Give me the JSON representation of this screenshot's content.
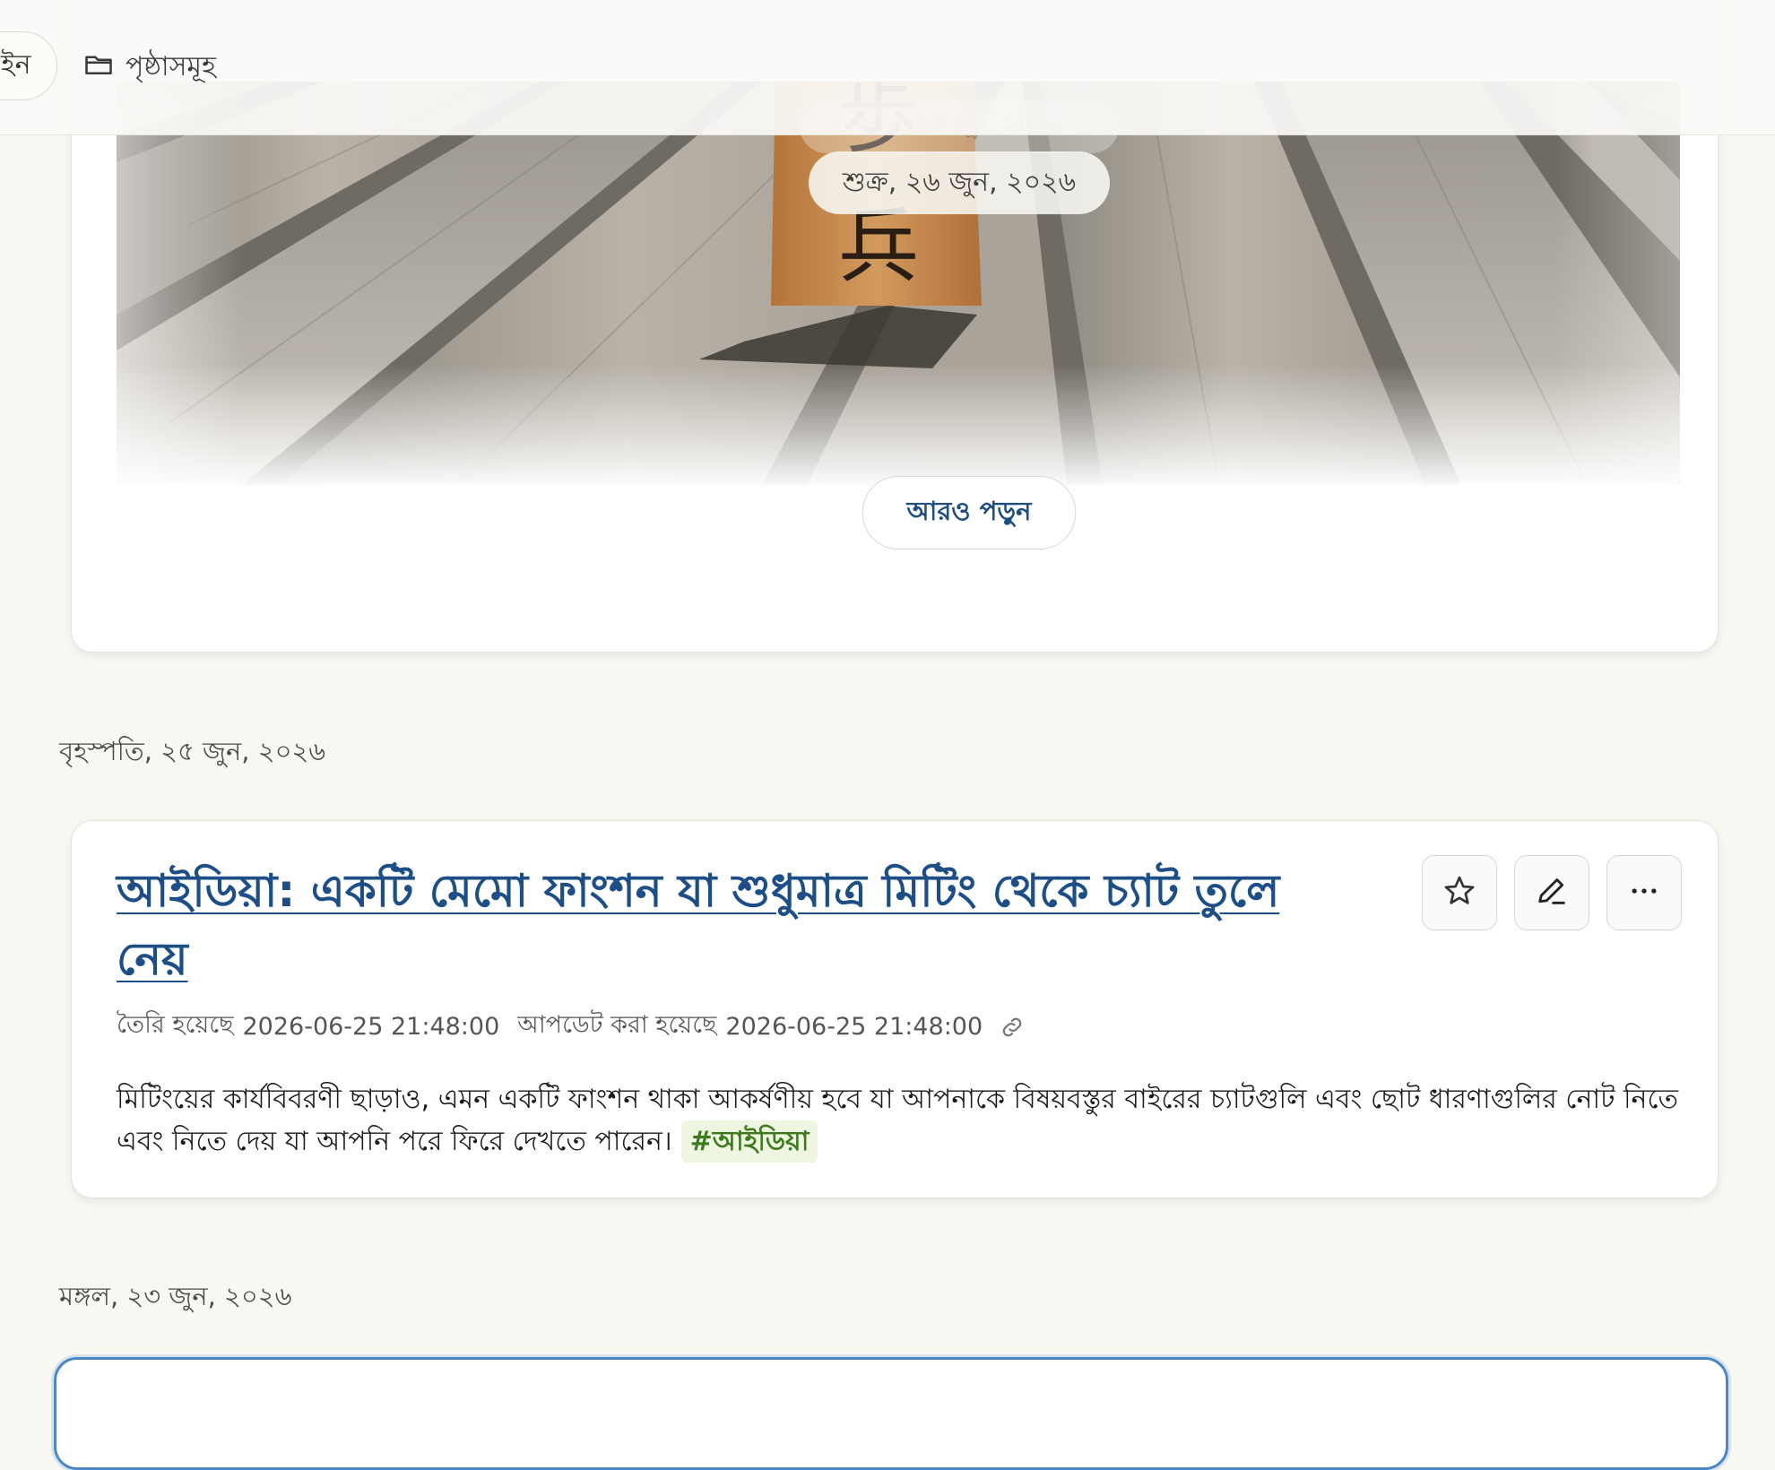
{
  "topbar": {
    "pill_partial_label": "ইন",
    "pages_label": "পৃষ্ঠাসমূহ"
  },
  "card1": {
    "image_date": "শুক্র, ২৬ জুন, ২০২৬",
    "ghost_date": "মঙ্গল, ২৩ জুন, ২০২৬",
    "read_more_label": "আরও পড়ুন"
  },
  "days": [
    {
      "label": "বৃহস্পতি, ২৫ জুন, ২০২৬"
    },
    {
      "label": "মঙ্গল, ২৩ জুন, ২০২৬"
    }
  ],
  "post": {
    "title": "আইডিয়া: একটি মেমো ফাংশন যা শুধুমাত্র মিটিং থেকে চ্যাট তুলে নেয়",
    "created_label": "তৈরি হয়েছে",
    "created_at": "2026-06-25 21:48:00",
    "updated_label": "আপডেট করা হয়েছে",
    "updated_at": "2026-06-25 21:48:00",
    "body": "মিটিংয়ের কার্যবিবরণী ছাড়াও, এমন একটি ফাংশন থাকা আকর্ষণীয় হবে যা আপনাকে বিষয়বস্তুর বাইরের চ্যাটগুলি এবং ছোট ধারণাগুলির নোট নিতে এবং নিতে দেয় যা আপনি পরে ফিরে দেখতে পারেন।",
    "tag": "#আইডিয়া"
  },
  "colors": {
    "accent": "#1d4f86",
    "tag_bg": "#eef5e0",
    "tag_text": "#3c7a1d",
    "focus_border": "#4a86c8",
    "page_bg": "#f8f8f3"
  },
  "icons": {
    "pages": "folder-icon",
    "favorite": "star-icon",
    "edit": "pencil-icon",
    "more": "more-horizontal-icon",
    "permalink": "link-icon"
  }
}
